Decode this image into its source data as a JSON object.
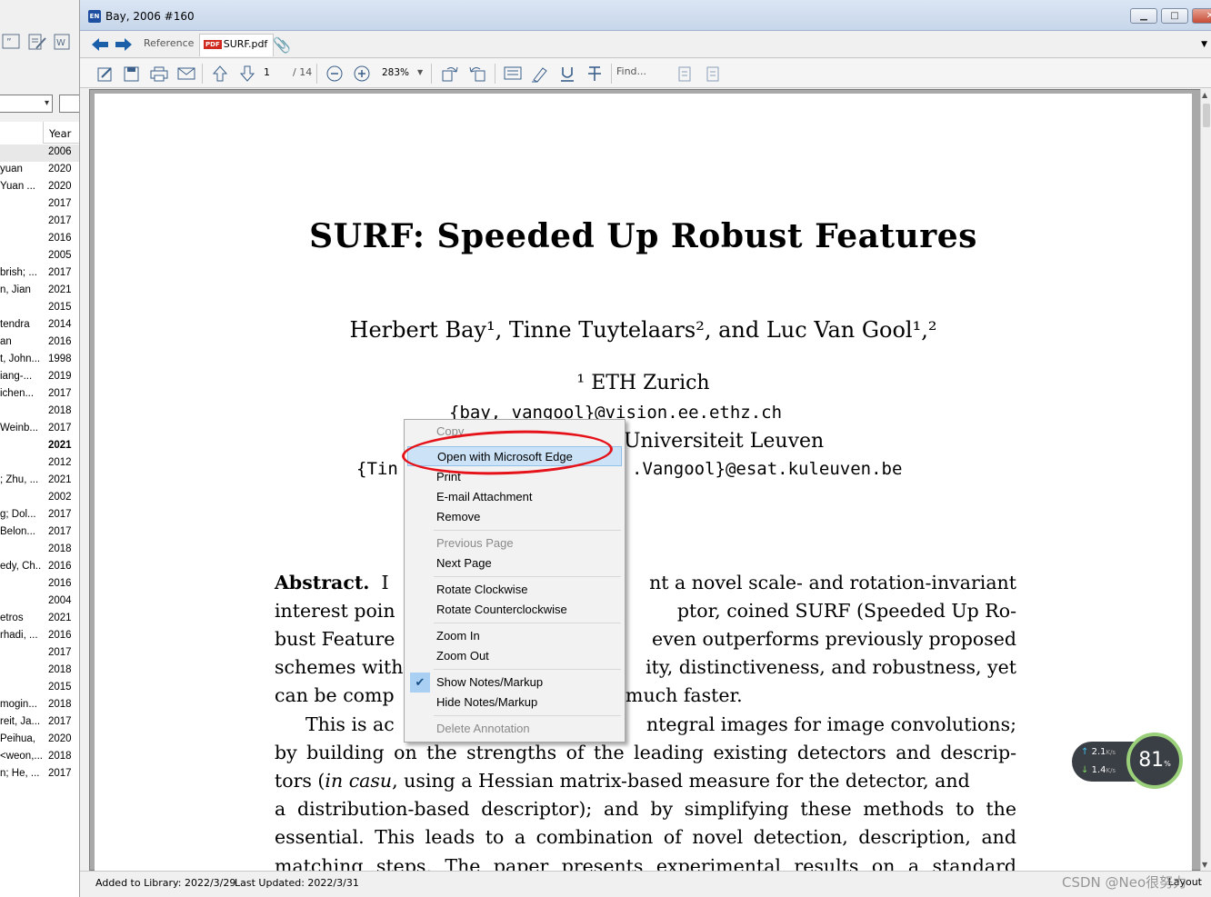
{
  "library": {
    "year_header": "Year",
    "rows": [
      {
        "author": "",
        "year": "2006"
      },
      {
        "author": "yuan",
        "year": "2020"
      },
      {
        "author": "Yuan ...",
        "year": "2020"
      },
      {
        "author": "",
        "year": "2017"
      },
      {
        "author": "",
        "year": "2017"
      },
      {
        "author": "",
        "year": "2016"
      },
      {
        "author": "",
        "year": "2005"
      },
      {
        "author": "brish; ...",
        "year": "2017"
      },
      {
        "author": "n, Jian",
        "year": "2021"
      },
      {
        "author": "",
        "year": "2015"
      },
      {
        "author": "tendra",
        "year": "2014"
      },
      {
        "author": "an",
        "year": "2016"
      },
      {
        "author": "t, John...",
        "year": "1998"
      },
      {
        "author": "iang-...",
        "year": "2019"
      },
      {
        "author": "ichen...",
        "year": "2017"
      },
      {
        "author": "",
        "year": "2018"
      },
      {
        "author": "Weinb...",
        "year": "2017"
      },
      {
        "author": "",
        "year": "2021"
      },
      {
        "author": "",
        "year": "2012"
      },
      {
        "author": "; Zhu, ...",
        "year": "2021"
      },
      {
        "author": "",
        "year": "2002"
      },
      {
        "author": "g; Dol...",
        "year": "2017"
      },
      {
        "author": "Belon...",
        "year": "2017"
      },
      {
        "author": "",
        "year": "2018"
      },
      {
        "author": "edy, Ch...",
        "year": "2016"
      },
      {
        "author": "",
        "year": "2016"
      },
      {
        "author": "",
        "year": "2004"
      },
      {
        "author": "etros",
        "year": "2021"
      },
      {
        "author": "rhadi, ...",
        "year": "2016"
      },
      {
        "author": "",
        "year": "2017"
      },
      {
        "author": "",
        "year": "2018"
      },
      {
        "author": "",
        "year": "2015"
      },
      {
        "author": "mogin...",
        "year": "2018"
      },
      {
        "author": "reit, Ja...",
        "year": "2017"
      },
      {
        "author": "Peihua,",
        "year": "2020"
      },
      {
        "author": "<weon,...",
        "year": "2018"
      },
      {
        "author": "n; He, ...",
        "year": "2017"
      }
    ]
  },
  "window": {
    "app_icon": "EN",
    "title": "Bay, 2006 #160",
    "min": "▁",
    "max": "□",
    "close": "✕"
  },
  "tabs": {
    "reference": "Reference",
    "pdf_badge": "PDF",
    "pdf": "SURF.pdf"
  },
  "toolbar": {
    "page_current": "1",
    "page_total": "/ 14",
    "zoom": "283%",
    "find_placeholder": "Find..."
  },
  "paper": {
    "title": "SURF: Speeded Up Robust Features",
    "authors": "Herbert Bay¹, Tinne Tuytelaars², and Luc Van Gool¹,²",
    "aff1": "¹  ETH Zurich",
    "email1": "{bay, vangool}@vision.ee.ethz.ch",
    "aff2": "Universiteit Leuven",
    "email2_left": "{Tin",
    "email2_right": ".Vangool}@esat.kuleuven.be",
    "abstract_label": "Abstract.",
    "l1_left": "I",
    "l1_right": "nt a novel scale- and rotation-invariant",
    "l2_left": "interest poin",
    "l2_right": "ptor, coined SURF (Speeded Up Ro-",
    "l3_left": "bust Feature",
    "l3_right": "even outperforms previously proposed",
    "l4_left": "schemes with",
    "l4_right": "ity, distinctiveness, and robustness, yet",
    "l5_left": "can be comp",
    "l5_right": "much faster.",
    "l6_left": "This is ac",
    "l6_right": "ntegral images for image convolutions;",
    "l7": "by building on the strengths of the leading existing detectors and descrip-",
    "l8_pre": "tors (",
    "l8_ital": "in casu",
    "l8_post": ", using a Hessian matrix-based measure for the detector, and",
    "l9": "a distribution-based descriptor); and by simplifying these methods to the",
    "l10": "essential. This leads to a combination of novel detection, description, and",
    "l11": "matching steps. The paper presents experimental results on a standard"
  },
  "context_menu": {
    "copy": "Copy",
    "open_edge": "Open with Microsoft Edge",
    "print": "Print",
    "email_attachment": "E-mail Attachment",
    "remove": "Remove",
    "previous_page": "Previous Page",
    "next_page": "Next Page",
    "rotate_cw": "Rotate Clockwise",
    "rotate_ccw": "Rotate Counterclockwise",
    "zoom_in": "Zoom In",
    "zoom_out": "Zoom Out",
    "show_notes": "Show Notes/Markup",
    "hide_notes": "Hide Notes/Markup",
    "delete_annotation": "Delete Annotation"
  },
  "status": {
    "added": "Added to Library: 2022/3/29",
    "updated": "Last Updated: 2022/3/31",
    "layout": "Layout"
  },
  "network": {
    "up": "2.1",
    "up_unit": "K/s",
    "down": "1.4",
    "down_unit": "K/s",
    "gauge": "81",
    "gauge_unit": "%"
  },
  "watermark": "CSDN @Neo很努力",
  "colors": {
    "menu_highlight": "#cce3f7",
    "annotation_circle": "#e6121a",
    "pdf_badge": "#d02a20"
  }
}
